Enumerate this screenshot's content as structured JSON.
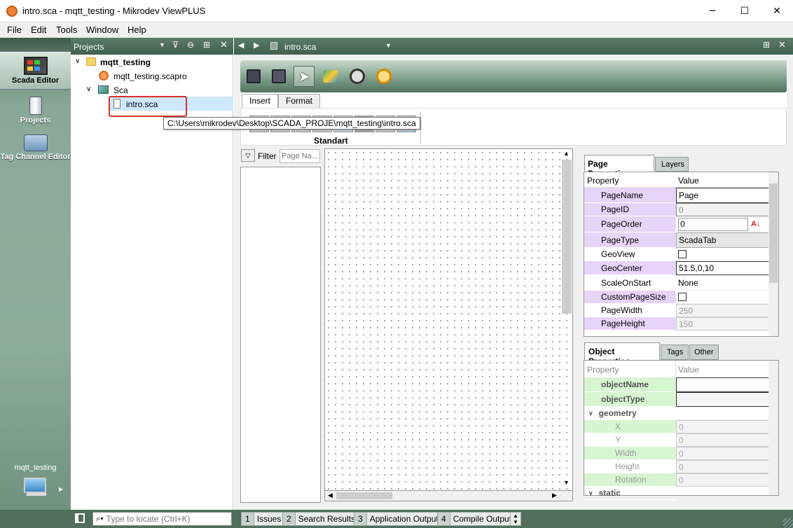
{
  "window": {
    "title": "intro.sca - mqtt_testing - Mikrodev ViewPLUS",
    "minimize": "─",
    "maximize": "☐",
    "close": "✕"
  },
  "menu": [
    "File",
    "Edit",
    "Tools",
    "Window",
    "Help"
  ],
  "left_modes": [
    {
      "label": "Scada Editor",
      "icon": "scada-editor-icon"
    },
    {
      "label": "Projects",
      "icon": "projects-icon"
    },
    {
      "label": "Tag Channel Editor",
      "icon": "tag-channel-icon"
    }
  ],
  "left_bottom": {
    "project": "mqtt_testing"
  },
  "projects_panel": {
    "title": "Projects",
    "tree": {
      "root": "mqtt_testing",
      "project_file": "mqtt_testing.scapro",
      "folder": "Sca",
      "file": "intro.sca"
    },
    "tooltip": "C:\\Users\\mikrodev\\Desktop\\SCADA_PROJE\\mqtt_testing\\intro.sca"
  },
  "editor": {
    "open_file": "intro.sca"
  },
  "ribbon_tabs": [
    "Insert",
    "Format"
  ],
  "palette_group": "Standart",
  "filter": {
    "label": "Filter :",
    "placeholder": "Page Na..."
  },
  "page_properties": {
    "tabs": [
      "Page Properties",
      "Layers"
    ],
    "header": {
      "property": "Property",
      "value": "Value"
    },
    "rows": [
      {
        "name": "PageName",
        "value": "Page"
      },
      {
        "name": "PageID",
        "value": "0"
      },
      {
        "name": "PageOrder",
        "value": "0"
      },
      {
        "name": "PageType",
        "value": "ScadaTab"
      },
      {
        "name": "GeoView",
        "value": ""
      },
      {
        "name": "GeoCenter",
        "value": "51.5,0,10"
      },
      {
        "name": "ScaleOnStart",
        "value": "None"
      },
      {
        "name": "CustomPageSize",
        "value": ""
      },
      {
        "name": "PageWidth",
        "value": "250"
      },
      {
        "name": "PageHeight",
        "value": "150"
      }
    ]
  },
  "object_properties": {
    "tabs": [
      "Object Properties",
      "Tags",
      "Other"
    ],
    "header": {
      "property": "Property",
      "value": "Value"
    },
    "rows": [
      {
        "name": "objectName",
        "value": ""
      },
      {
        "name": "objectType",
        "value": ""
      },
      {
        "name": "geometry",
        "value": ""
      },
      {
        "name": "X",
        "value": "0"
      },
      {
        "name": "Y",
        "value": "0"
      },
      {
        "name": "Width",
        "value": "0"
      },
      {
        "name": "Height",
        "value": "0"
      },
      {
        "name": "Rotation",
        "value": "0"
      },
      {
        "name": "static",
        "value": ""
      }
    ]
  },
  "statusbar": {
    "locate_placeholder": "Type to locate (Ctrl+K)",
    "tabs": [
      {
        "num": "1",
        "label": "Issues"
      },
      {
        "num": "2",
        "label": "Search Results"
      },
      {
        "num": "3",
        "label": "Application Output"
      },
      {
        "num": "4",
        "label": "Compile Output"
      }
    ]
  },
  "colors": {
    "accent": "#4f6e5c",
    "highlight_red": "#d9312b",
    "property_purple": "#e8d4f8",
    "property_green": "#d6f5d0"
  }
}
